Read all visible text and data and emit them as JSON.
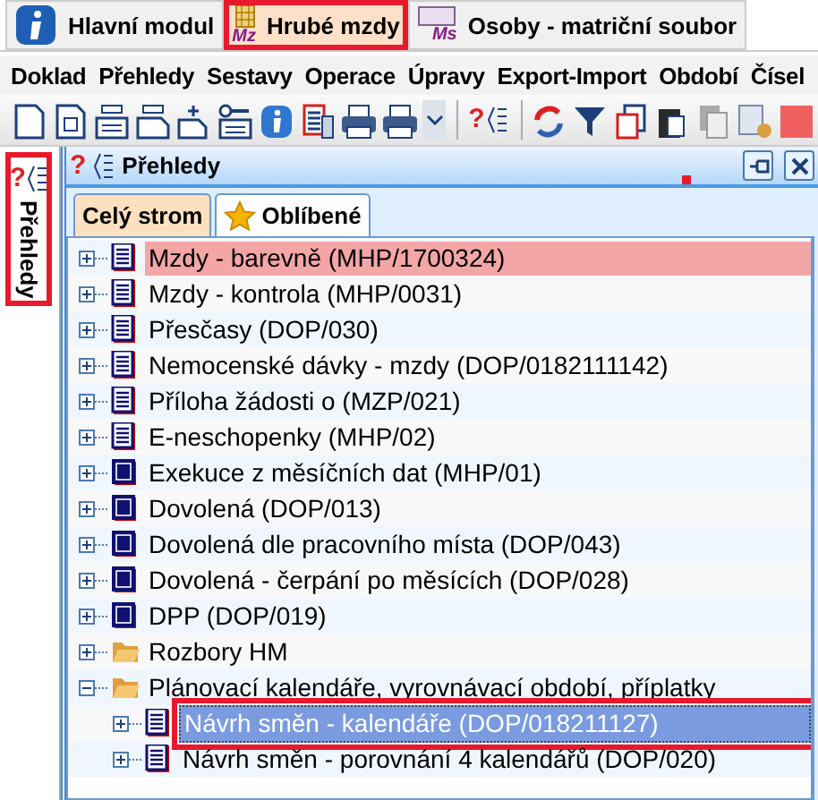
{
  "module_tabs": [
    {
      "label": "Hlavní modul",
      "selected": false,
      "highlighted": false
    },
    {
      "label": "Hrubé mzdy",
      "badge": "Mz",
      "selected": true,
      "highlighted": true
    },
    {
      "label": "Osoby - matriční soubor",
      "badge": "Ms",
      "selected": false,
      "highlighted": false
    }
  ],
  "menu": [
    {
      "label": "Doklad"
    },
    {
      "label": "Přehledy"
    },
    {
      "label": "Sestavy"
    },
    {
      "label": "Operace"
    },
    {
      "label": "Úpravy"
    },
    {
      "label": "Export-Import"
    },
    {
      "label": "Období"
    },
    {
      "label": "Čísel"
    }
  ],
  "toolbar": [
    {
      "kind": "new"
    },
    {
      "kind": "template"
    },
    {
      "kind": "form"
    },
    {
      "kind": "form2"
    },
    {
      "kind": "add"
    },
    {
      "kind": "tagform"
    },
    {
      "kind": "info"
    },
    {
      "kind": "report"
    },
    {
      "kind": "print"
    },
    {
      "kind": "print"
    },
    {
      "kind": "caret"
    },
    {
      "kind": "sep"
    },
    {
      "kind": "help",
      "glyph": "?"
    },
    {
      "kind": "sep"
    },
    {
      "kind": "refresh"
    },
    {
      "kind": "filter"
    },
    {
      "kind": "copy"
    },
    {
      "kind": "paste"
    },
    {
      "kind": "docs"
    },
    {
      "kind": "calc"
    },
    {
      "kind": "stop"
    }
  ],
  "side_tab": {
    "glyph": "?",
    "label": "Přehledy",
    "highlighted": true
  },
  "panel": {
    "glyph": "?",
    "title": "Přehledy",
    "tabs": [
      {
        "label": "Celý strom",
        "selected": true
      },
      {
        "label": "Oblíbené",
        "selected": false
      }
    ],
    "tree": [
      {
        "label": "Mzdy - barevně (MHP/1700324)",
        "kind": "report",
        "expanded": false,
        "selected": false,
        "color": "#f4a6a6"
      },
      {
        "label": "Mzdy - kontrola (MHP/0031)",
        "kind": "report",
        "expanded": false,
        "selected": false
      },
      {
        "label": "Přesčasy (DOP/030)",
        "kind": "report",
        "expanded": false,
        "selected": false
      },
      {
        "label": "Nemocenské dávky - mzdy (DOP/0182111142)",
        "kind": "report",
        "expanded": false,
        "selected": false
      },
      {
        "label": "Příloha žádosti o (MZP/021)",
        "kind": "report",
        "expanded": false,
        "selected": false
      },
      {
        "label": "E-neschopenky (MHP/02)",
        "kind": "report",
        "expanded": false,
        "selected": false
      },
      {
        "label": "Exekuce z měsíčních dat (MHP/01)",
        "kind": "block",
        "expanded": false,
        "selected": false
      },
      {
        "label": "Dovolená (DOP/013)",
        "kind": "block",
        "expanded": false,
        "selected": false
      },
      {
        "label": "Dovolená dle pracovního místa (DOP/043)",
        "kind": "block",
        "expanded": false,
        "selected": false
      },
      {
        "label": "Dovolená - čerpání po měsících (DOP/028)",
        "kind": "block",
        "expanded": false,
        "selected": false
      },
      {
        "label": "DPP (DOP/019)",
        "kind": "block",
        "expanded": false,
        "selected": false
      },
      {
        "label": "Rozbory HM",
        "kind": "folder",
        "expanded": false,
        "selected": false
      },
      {
        "label": "Plánovací kalendáře, vyrovnávací období, příplatky",
        "kind": "folder",
        "expanded": true,
        "selected": false,
        "children": [
          {
            "label": "Návrh směn - kalendáře (DOP/018211127)",
            "kind": "report",
            "expanded": false,
            "selected": true,
            "highlighted": true
          },
          {
            "label": "Návrh směn - porovnání 4 kalendářů (DOP/020)",
            "kind": "report",
            "expanded": false,
            "selected": false
          }
        ]
      }
    ]
  }
}
